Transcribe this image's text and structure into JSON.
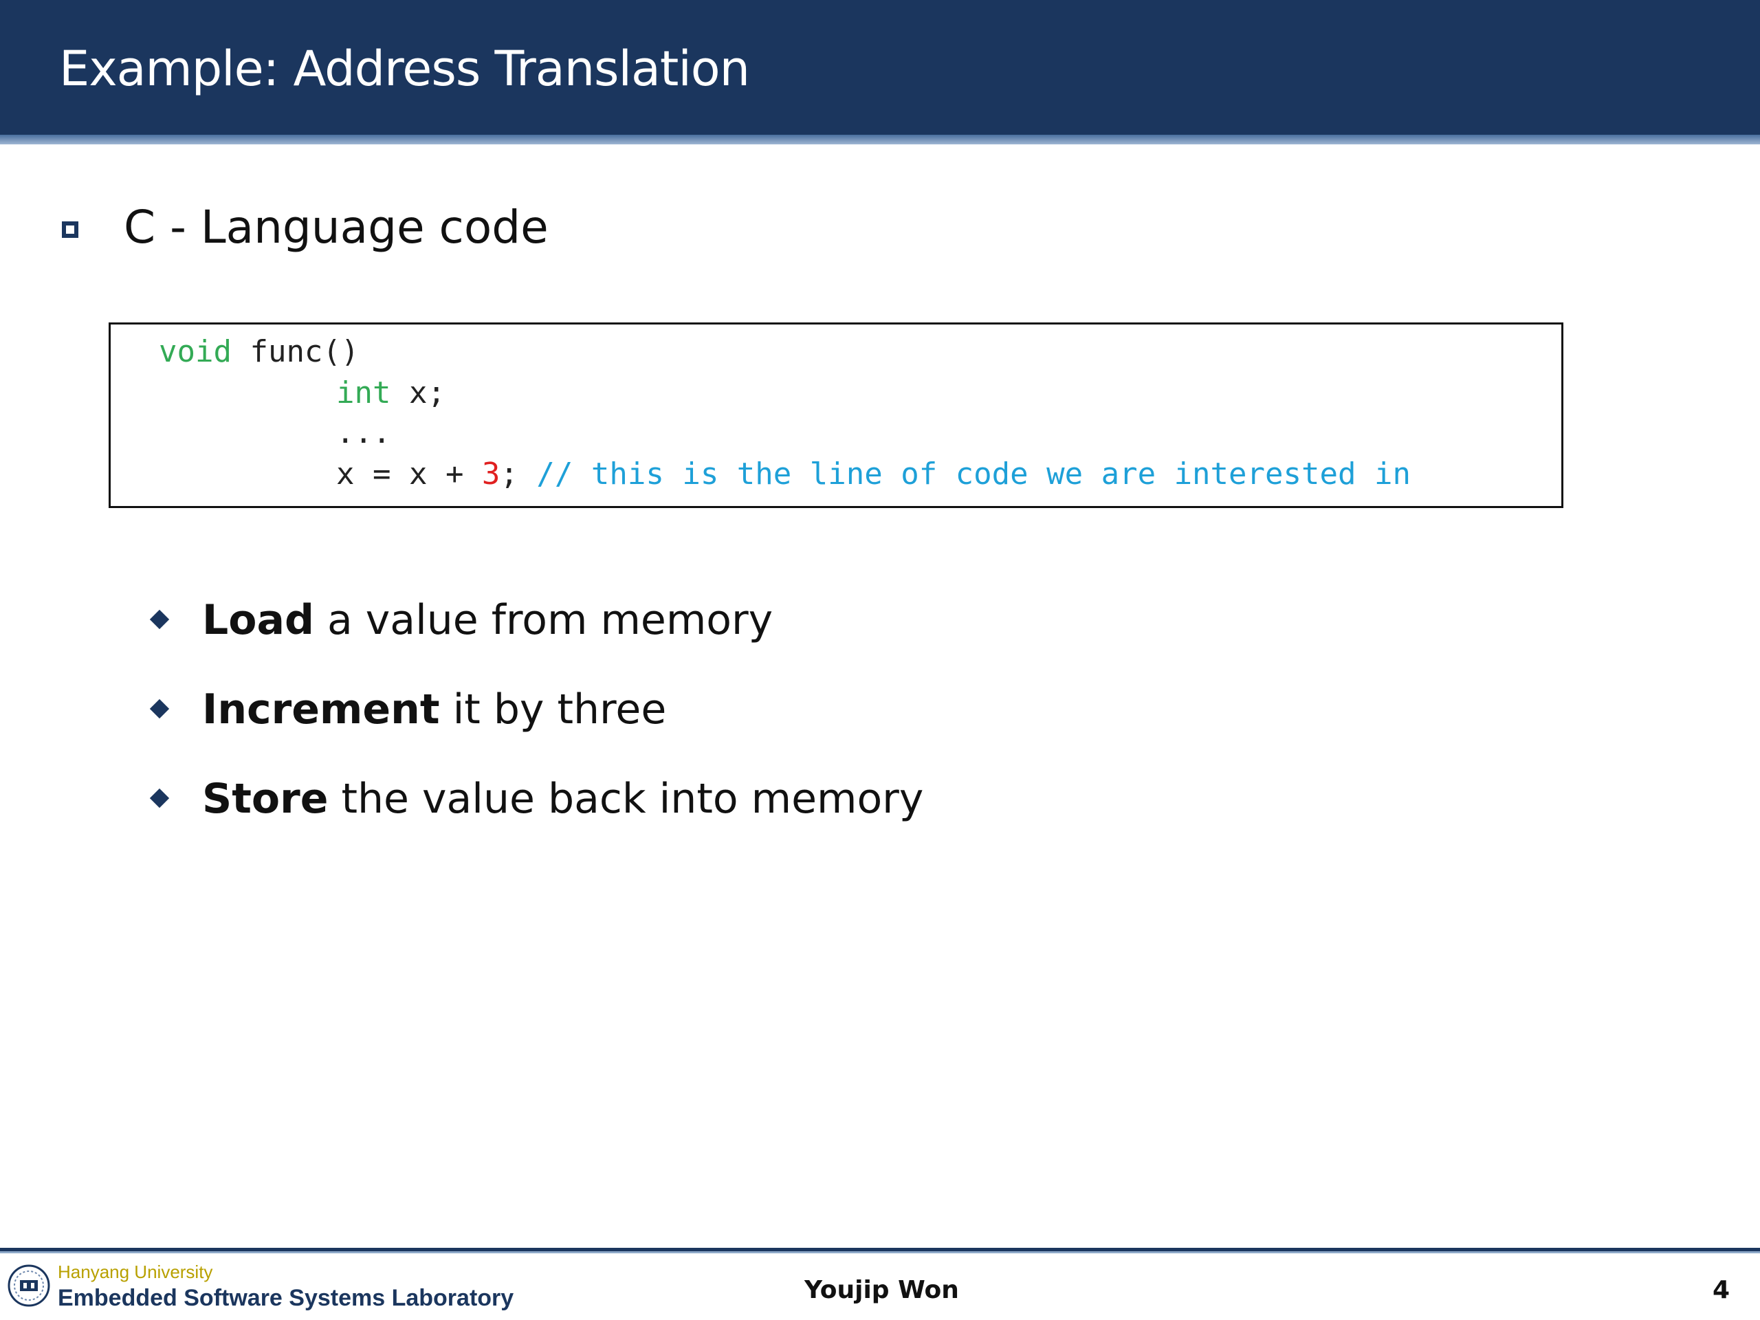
{
  "slide": {
    "title": "Example: Address Translation"
  },
  "main_bullet": {
    "text": "C - Language code"
  },
  "code": {
    "line1": {
      "keyword": "void",
      "rest": " func()"
    },
    "line2": {
      "keyword": "int",
      "rest": " x;"
    },
    "line3": {
      "text": "..."
    },
    "line4": {
      "before": "x = x + ",
      "number": "3",
      "semicolon": "; ",
      "comment": "// this is the line of code we are interested in"
    }
  },
  "sub_bullets": [
    {
      "bold": "Load",
      "text": " a value from memory"
    },
    {
      "bold": "Increment",
      "text": " it by three"
    },
    {
      "bold": "Store",
      "text": " the value back into memory"
    }
  ],
  "footer": {
    "university": "Hanyang University",
    "lab": "Embedded Software Systems Laboratory",
    "presenter": "Youjip Won",
    "page_number": "4"
  },
  "colors": {
    "header_bg": "#1b365e",
    "keyword": "#33aa55",
    "number": "#e02020",
    "comment": "#1ea0d8"
  }
}
